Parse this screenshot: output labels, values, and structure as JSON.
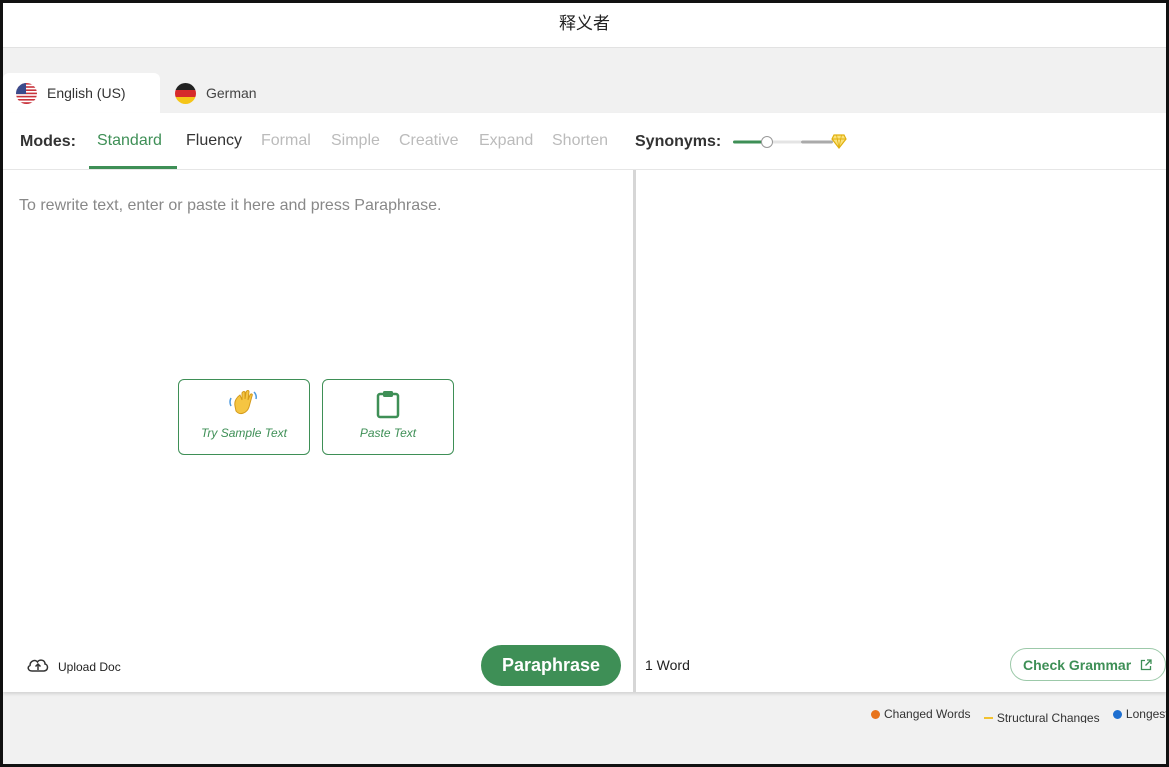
{
  "window": {
    "title": "释义者"
  },
  "languages": {
    "active": {
      "label": "English (US)",
      "flag": "us-flag-icon"
    },
    "inactive": {
      "label": "German",
      "flag": "germany-flag-icon"
    }
  },
  "modes": {
    "label": "Modes:",
    "items": [
      "Standard",
      "Fluency",
      "Formal",
      "Simple",
      "Creative",
      "Expand",
      "Shorten"
    ],
    "selected": "Standard"
  },
  "synonyms": {
    "label": "Synonyms:",
    "level": 0.3,
    "premium_icon": "diamond-icon"
  },
  "input": {
    "placeholder": "To rewrite text, enter or paste it here and press Paraphrase.",
    "try_sample_label": "Try Sample Text",
    "paste_label": "Paste Text"
  },
  "footer": {
    "upload_label": "Upload Doc",
    "paraphrase_label": "Paraphrase",
    "word_count": "1 Word",
    "check_grammar_label": "Check Grammar"
  },
  "legend": [
    {
      "label": "Changed Words",
      "color": "#e8741c",
      "shape": "dot"
    },
    {
      "label": "Structural Changes",
      "color": "#f2c230",
      "shape": "dash"
    },
    {
      "label": "Longest Unchanged Words",
      "color": "#1e6fd0",
      "shape": "dot"
    }
  ],
  "colors": {
    "accent": "#3e8f56",
    "diamond": "#f0c020"
  }
}
